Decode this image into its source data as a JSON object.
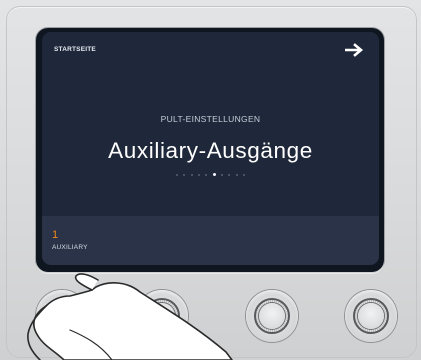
{
  "screen": {
    "home_label": "STARTSEITE",
    "nav_icon": "arrow-right-icon",
    "subtitle": "PULT-EINSTELLUNGEN",
    "title": "Auxiliary-Ausgänge",
    "pagination": {
      "total": 10,
      "active": 6
    }
  },
  "control": {
    "value": "1",
    "label": "AUXILIARY",
    "value_color": "#f08a1c"
  },
  "knobs": [
    "knob-1",
    "knob-2",
    "knob-3",
    "knob-4"
  ]
}
